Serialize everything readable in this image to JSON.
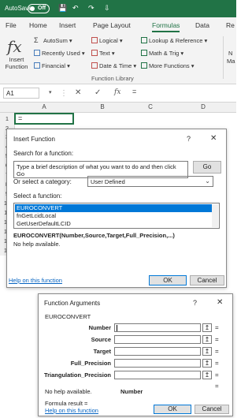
{
  "titlebar": {
    "autosave_label": "AutoSave",
    "toggle_state": "Off",
    "save_glyph": "💾",
    "undo_glyph": "↶",
    "redo_glyph": "↷",
    "customize_glyph": "⇩"
  },
  "ribbon_tabs": [
    "File",
    "Home",
    "Insert",
    "Page Layout",
    "Formulas",
    "Data",
    "Re"
  ],
  "active_tab": "Formulas",
  "ribbon": {
    "insert_function": {
      "glyph": "fx",
      "line1": "Insert",
      "line2": "Function"
    },
    "col1": [
      "AutoSum ▾",
      "Recently Used ▾",
      "Financial ▾"
    ],
    "col2": [
      "Logical ▾",
      "Text ▾",
      "Date & Time ▾"
    ],
    "col3": [
      "Lookup & Reference ▾",
      "Math & Trig ▾",
      "More Functions ▾"
    ],
    "autosum_glyph": "Σ",
    "group_label": "Function Library",
    "cut_label_1": "N",
    "cut_label_2": "Ma"
  },
  "formula_bar": {
    "name_box": "A1",
    "cancel_glyph": "✕",
    "enter_glyph": "✓",
    "fx_glyph": "fx",
    "formula": "="
  },
  "grid": {
    "columns": [
      "A",
      "B",
      "C",
      "D"
    ],
    "rows": [
      "1",
      "2",
      "3",
      "4",
      "5",
      "6",
      "7",
      "8",
      "9",
      "10",
      "11",
      "12",
      "13",
      "14",
      "15"
    ],
    "a1_value": "="
  },
  "insert_dialog": {
    "title": "Insert Function",
    "help_glyph": "?",
    "close_glyph": "✕",
    "search_label": "Search for a function:",
    "search_text": "Type a brief description of what you want to do and then click Go",
    "go_label": "Go",
    "category_label": "Or select a category:",
    "category_value": "User Defined",
    "select_label": "Select a function:",
    "functions": [
      "EUROCONVERT",
      "fnGetLcidLocal",
      "GetUserDefaultLCID"
    ],
    "signature": "EUROCONVERT(Number,Source,Target,Full_Precision,...)",
    "description": "No help available.",
    "help_link": "Help on this function",
    "ok_label": "OK",
    "cancel_label": "Cancel"
  },
  "args_dialog": {
    "title": "Function Arguments",
    "help_glyph": "?",
    "close_glyph": "✕",
    "function_name": "EUROCONVERT",
    "args": [
      "Number",
      "Source",
      "Target",
      "Full_Precision",
      "Triangulation_Precision"
    ],
    "collapse_glyph": "↥",
    "equals": "=",
    "result_equals": "=",
    "no_help": "No help available.",
    "current_arg": "Number",
    "formula_result": "Formula result =",
    "help_link": "Help on this function",
    "ok_label": "OK",
    "cancel_label": "Cancel"
  },
  "colors": {
    "excel_green": "#217346",
    "selection_blue": "#0078d7",
    "link_blue": "#0563c1"
  }
}
